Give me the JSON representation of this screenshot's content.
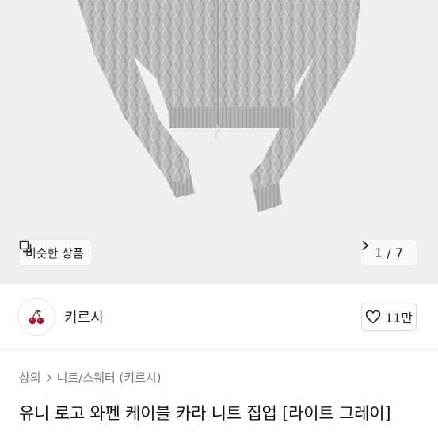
{
  "product_image": {
    "similar_button_label": "비슷한 상품",
    "pager_text": "1 / 7"
  },
  "shop": {
    "name": "키르시",
    "like_count": "11만"
  },
  "breadcrumb": {
    "category": "상의",
    "subcategory": "니트/스웨터 (키르시)"
  },
  "product": {
    "title": "유니 로고 와펜 케이블 카라 니트 집업 [라이트 그레이]"
  },
  "colors": {
    "hero_bg": "#efefef",
    "sweater": "#b9bcb8",
    "cherry": "#b3122a"
  },
  "icons": {
    "similar": "copy-icon",
    "pager": "chevron-right-icon",
    "avatar": "cherry-icon",
    "like": "heart-icon",
    "breadcrumb": "chevron-right-icon"
  }
}
